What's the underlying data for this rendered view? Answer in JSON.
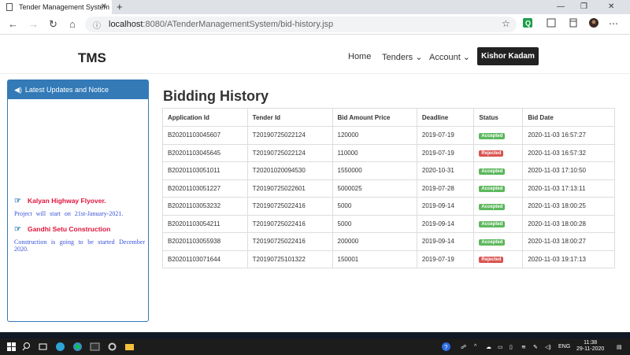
{
  "browser": {
    "tab_title": "Tender Management System",
    "url_host": "localhost",
    "url_path": ":8080/ATenderManagementSystem/bid-history.jsp"
  },
  "nav": {
    "brand": "TMS",
    "items": [
      {
        "label": "Home"
      },
      {
        "label": "Tenders ⌄"
      },
      {
        "label": "Account ⌄"
      }
    ],
    "user": "Kishor Kadam"
  },
  "sidebar": {
    "title": "Latest Updates and Notice",
    "notices": [
      {
        "title": "Kalyan Highway Flyover.",
        "text": "Project will start on 21st-January-2021."
      },
      {
        "title": "Gandhi Setu Construction",
        "text": "Construction is going to be started December 2020."
      }
    ]
  },
  "page": {
    "title": "Bidding History",
    "columns": [
      "Application Id",
      "Tender Id",
      "Bid Amount Price",
      "Deadline",
      "Status",
      "Bid Date"
    ],
    "rows": [
      {
        "app": "B20201103045607",
        "tender": "T20190725022124",
        "amount": "120000",
        "deadline": "2019-07-19",
        "status": "Accepted",
        "date": "2020-11-03 16:57:27"
      },
      {
        "app": "B20201103045645",
        "tender": "T20190725022124",
        "amount": "110000",
        "deadline": "2019-07-19",
        "status": "Rejected",
        "date": "2020-11-03 16:57:32"
      },
      {
        "app": "B20201103051011",
        "tender": "T20201020094530",
        "amount": "1550000",
        "deadline": "2020-10-31",
        "status": "Accepted",
        "date": "2020-11-03 17:10:50"
      },
      {
        "app": "B20201103051227",
        "tender": "T20190725022601",
        "amount": "5000025",
        "deadline": "2019-07-28",
        "status": "Accepted",
        "date": "2020-11-03 17:13:11"
      },
      {
        "app": "B20201103053232",
        "tender": "T20190725022416",
        "amount": "5000",
        "deadline": "2019-09-14",
        "status": "Accepted",
        "date": "2020-11-03 18:00:25"
      },
      {
        "app": "B20201103054211",
        "tender": "T20190725022416",
        "amount": "5000",
        "deadline": "2019-09-14",
        "status": "Accepted",
        "date": "2020-11-03 18:00:28"
      },
      {
        "app": "B20201103055938",
        "tender": "T20190725022416",
        "amount": "200000",
        "deadline": "2019-09-14",
        "status": "Accepted",
        "date": "2020-11-03 18:00:27"
      },
      {
        "app": "B20201103071644",
        "tender": "T20190725101322",
        "amount": "150001",
        "deadline": "2019-07-19",
        "status": "Rejected",
        "date": "2020-11-03 19:17:13"
      }
    ]
  },
  "taskbar": {
    "lang": "ENG",
    "time": "11:38",
    "date": "29-11-2020"
  },
  "colors": {
    "primary": "#337ab7",
    "accepted": "#5cb85c",
    "rejected": "#d9534f",
    "notice_title": "#e0143c"
  }
}
